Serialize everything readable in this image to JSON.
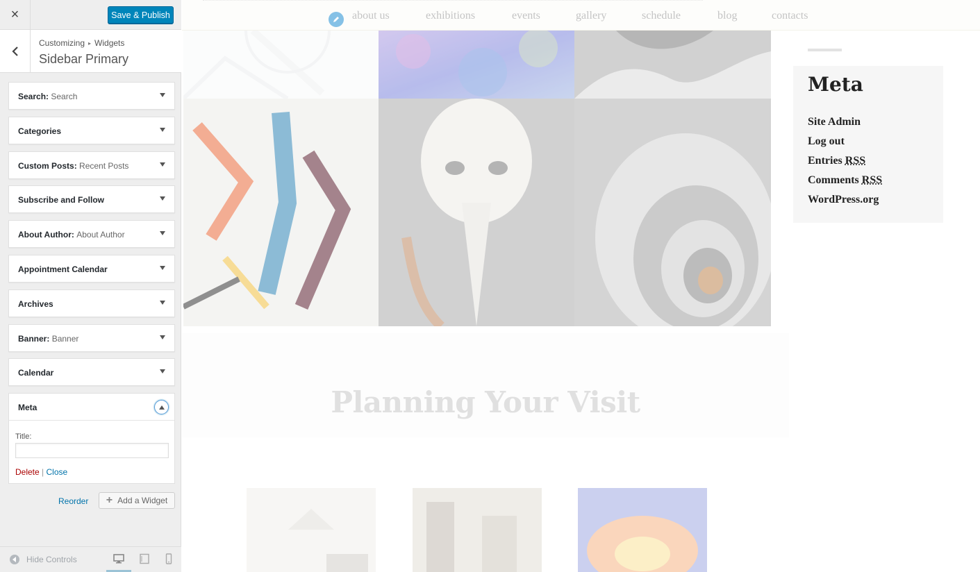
{
  "customizer": {
    "close_label": "×",
    "save_label": "Save & Publish",
    "breadcrumb": {
      "root": "Customizing",
      "separator": "▸",
      "parent": "Widgets"
    },
    "section_title": "Sidebar Primary",
    "widgets": [
      {
        "title": "Search",
        "subtitle": "Search"
      },
      {
        "title": "Categories",
        "subtitle": ""
      },
      {
        "title": "Custom Posts",
        "subtitle": "Recent Posts"
      },
      {
        "title": "Subscribe and Follow",
        "subtitle": ""
      },
      {
        "title": "About Author",
        "subtitle": "About Author"
      },
      {
        "title": "Appointment Calendar",
        "subtitle": ""
      },
      {
        "title": "Archives",
        "subtitle": ""
      },
      {
        "title": "Banner",
        "subtitle": "Banner"
      },
      {
        "title": "Calendar",
        "subtitle": ""
      }
    ],
    "open_widget": {
      "title": "Meta",
      "field_label": "Title:",
      "field_value": "",
      "delete_label": "Delete",
      "divider": "|",
      "close_label": "Close"
    },
    "reorder_label": "Reorder",
    "add_widget_label": "Add a Widget",
    "hide_controls_label": "Hide Controls",
    "devices": [
      "desktop-icon",
      "tablet-icon",
      "mobile-icon"
    ]
  },
  "preview": {
    "nav": [
      "about us",
      "exhibitions",
      "events",
      "gallery",
      "schedule",
      "blog",
      "contacts"
    ],
    "section_heading": "Planning Your Visit",
    "sidebar_widget": {
      "title": "Meta",
      "links": [
        {
          "text": "Site Admin",
          "abbr": ""
        },
        {
          "text": "Log out",
          "abbr": ""
        },
        {
          "text": "Entries ",
          "abbr": "RSS"
        },
        {
          "text": "Comments ",
          "abbr": "RSS"
        },
        {
          "text": "WordPress.org",
          "abbr": ""
        }
      ]
    }
  },
  "colors": {
    "primary_button": "#0085ba",
    "link": "#0073aa",
    "delete": "#aa0000",
    "panel_bg": "#eeeeee"
  }
}
